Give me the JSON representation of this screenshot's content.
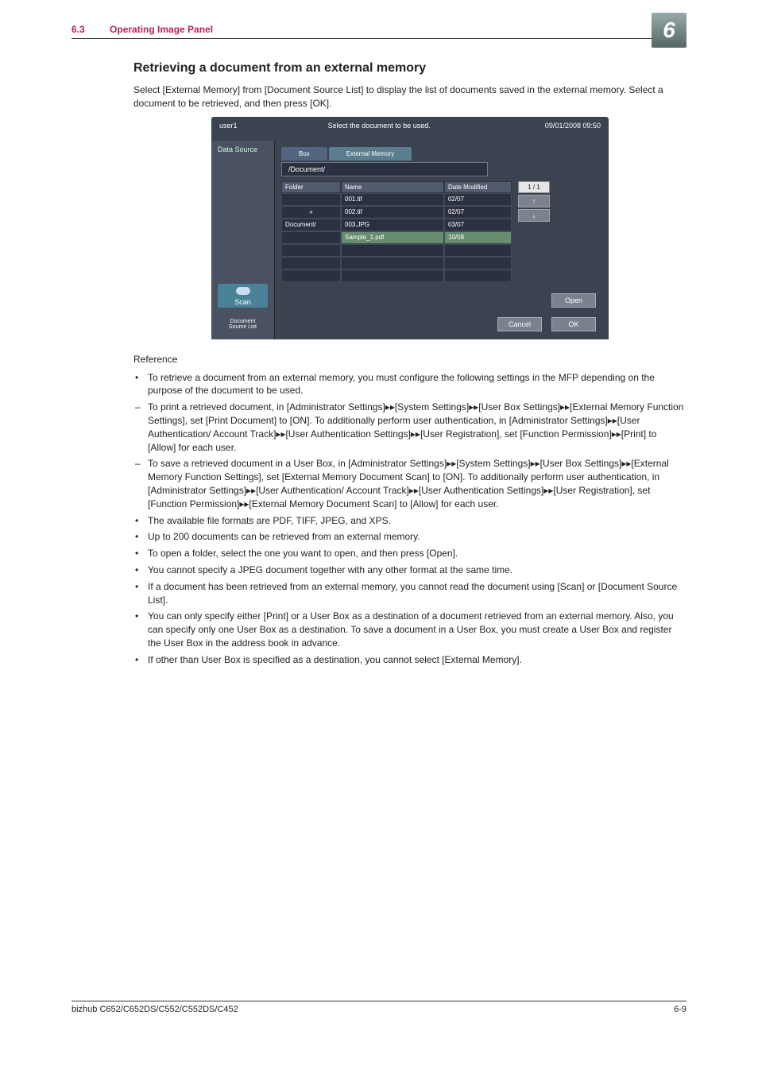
{
  "header": {
    "section_no": "6.3",
    "section_title": "Operating Image Panel",
    "chapter_badge": "6"
  },
  "heading": "Retrieving a document from an external memory",
  "intro_para": "Select [External Memory] from [Document Source List] to display the list of documents saved in the external memory. Select a document to be retrieved, and then press [OK].",
  "screenshot": {
    "user": "user1",
    "title": "Select the document to be used.",
    "datetime": "09/01/2008 09:50",
    "sidelabel": "Data Source",
    "scan": "Scan",
    "docsrc_l1": "Document",
    "docsrc_l2": "Source List",
    "tab_box": "Box",
    "tab_ext": "External Memory",
    "path": "/Document/",
    "col_folder": "Folder",
    "col_name": "Name",
    "col_date": "Date Modified",
    "folders": [
      "",
      "«",
      "Document/"
    ],
    "names": [
      "001.tif",
      "002.tif",
      "003.JPG",
      "Sample_1.pdf"
    ],
    "dates": [
      "02/07",
      "02/07",
      "03/07",
      "10/08"
    ],
    "pagectr": "1 / 1",
    "open": "Open",
    "cancel": "Cancel",
    "ok": "OK"
  },
  "reference_label": "Reference",
  "bullets": {
    "b1": "To retrieve a document from an external memory, you must configure the following settings in the MFP depending on the purpose of the document to be used.",
    "d1": "To print a retrieved document, in [Administrator Settings]▸▸[System Settings]▸▸[User Box Settings]▸▸[External Memory Function Settings], set [Print Document] to [ON]. To additionally perform user authentication, in [Administrator Settings]▸▸[User Authentication/ Account Track]▸▸[User Authentication Settings]▸▸[User Registration], set [Function Permission]▸▸[Print] to [Allow] for each user.",
    "d2": "To save a retrieved document in a User Box, in [Administrator Settings]▸▸[System Settings]▸▸[User Box Settings]▸▸[External Memory Function Settings], set [External Memory Document Scan] to [ON].  To additionally perform user authentication, in [Administrator Settings]▸▸[User Authentication/ Account Track]▸▸[User Authentication Settings]▸▸[User Registration], set [Function Permission]▸▸[External Memory Document Scan] to [Allow] for each user.",
    "b2": "The available file formats are PDF, TIFF, JPEG, and XPS.",
    "b3": "Up to 200 documents can be retrieved from an external memory.",
    "b4": "To open a folder, select the one you want to open, and then press [Open].",
    "b5": "You cannot specify a JPEG document together with any other format at the same time.",
    "b6": "If a document has been retrieved from an external memory, you cannot read the document using [Scan] or [Document Source List].",
    "b7": "You can only specify either [Print] or a User Box as a destination of a document retrieved from an external memory. Also, you can specify only one User Box as a destination. To save a document in a User Box, you must create a User Box and register the User Box in the address book in advance.",
    "b8": "If other than User Box is specified as a destination, you cannot select [External Memory]."
  },
  "footer": {
    "left": "bizhub C652/C652DS/C552/C552DS/C452",
    "right": "6-9"
  }
}
